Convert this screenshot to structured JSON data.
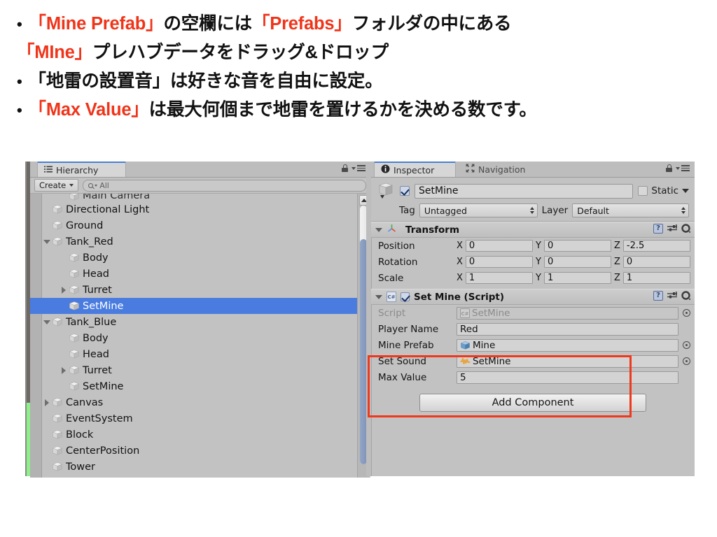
{
  "slide": {
    "lines": [
      {
        "bullet": "•",
        "segments": [
          {
            "t": "「Mine Prefab」",
            "hl": true
          },
          {
            "t": "の空欄には",
            "hl": false
          },
          {
            "t": "「Prefabs」",
            "hl": true
          },
          {
            "t": "フォルダの中にある",
            "hl": false
          }
        ]
      },
      {
        "bullet": "",
        "segments": [
          {
            "t": "「MIne」",
            "hl": true
          },
          {
            "t": "プレハブデータをドラッグ&ドロップ",
            "hl": false
          }
        ]
      },
      {
        "bullet": "•",
        "segments": [
          {
            "t": "「地雷の設置音」は好きな音を自由に設定。",
            "hl": false
          }
        ]
      },
      {
        "bullet": "•",
        "segments": [
          {
            "t": "「Max Value」",
            "hl": true
          },
          {
            "t": "は最大何個まで地雷を置けるかを決める数です。",
            "hl": false
          }
        ]
      }
    ],
    "highlight_color": "#f0341a",
    "text_color": "#111111"
  },
  "hierarchy": {
    "tab_label": "Hierarchy",
    "tab_icon": "hierarchy-icon",
    "lock_icon": "lock-icon",
    "menu_icon": "panel-menu-icon",
    "create_button": "Create",
    "search_placeholder": "All",
    "search_value": "All",
    "search_icon": "search-icon",
    "clipped_top_row": "Main Camera",
    "rows": [
      {
        "label": "Directional Light",
        "indent": 1,
        "disclosure": "none",
        "selected": false
      },
      {
        "label": "Ground",
        "indent": 1,
        "disclosure": "none",
        "selected": false
      },
      {
        "label": "Tank_Red",
        "indent": 1,
        "disclosure": "down",
        "selected": false
      },
      {
        "label": "Body",
        "indent": 2,
        "disclosure": "none",
        "selected": false
      },
      {
        "label": "Head",
        "indent": 2,
        "disclosure": "none",
        "selected": false
      },
      {
        "label": "Turret",
        "indent": 2,
        "disclosure": "right",
        "selected": false
      },
      {
        "label": "SetMine",
        "indent": 2,
        "disclosure": "none",
        "selected": true
      },
      {
        "label": "Tank_Blue",
        "indent": 1,
        "disclosure": "down",
        "selected": false
      },
      {
        "label": "Body",
        "indent": 2,
        "disclosure": "none",
        "selected": false
      },
      {
        "label": "Head",
        "indent": 2,
        "disclosure": "none",
        "selected": false
      },
      {
        "label": "Turret",
        "indent": 2,
        "disclosure": "right",
        "selected": false
      },
      {
        "label": "SetMine",
        "indent": 2,
        "disclosure": "none",
        "selected": false
      },
      {
        "label": "Canvas",
        "indent": 1,
        "disclosure": "right",
        "selected": false
      },
      {
        "label": "EventSystem",
        "indent": 1,
        "disclosure": "none",
        "selected": false
      },
      {
        "label": "Block",
        "indent": 1,
        "disclosure": "none",
        "selected": false
      },
      {
        "label": "CenterPosition",
        "indent": 1,
        "disclosure": "none",
        "selected": false
      },
      {
        "label": "Tower",
        "indent": 1,
        "disclosure": "none",
        "selected": false
      }
    ],
    "selection_color": "#4a7ce0"
  },
  "inspector": {
    "tabs": [
      {
        "label": "Inspector",
        "icon": "info-icon",
        "active": true
      },
      {
        "label": "Navigation",
        "icon": "navigation-icon",
        "active": false
      }
    ],
    "lock_icon": "lock-icon",
    "menu_icon": "panel-menu-icon",
    "gameobject": {
      "icon": "gameobject-cube-icon",
      "enabled_checkbox": "checked",
      "name": "SetMine",
      "static_label": "Static",
      "static_checkbox": "unchecked",
      "tag_label": "Tag",
      "tag_value": "Untagged",
      "layer_label": "Layer",
      "layer_value": "Default"
    },
    "components": [
      {
        "title": "Transform",
        "icon": "transform-axis-icon",
        "expanded": true,
        "help_icon": "help-icon",
        "preset_icon": "preset-icon",
        "gear_icon": "gear-icon",
        "vector_rows": [
          {
            "label": "Position",
            "x": "0",
            "y": "0",
            "z": "-2.5"
          },
          {
            "label": "Rotation",
            "x": "0",
            "y": "0",
            "z": "0"
          },
          {
            "label": "Scale",
            "x": "1",
            "y": "1",
            "z": "1"
          }
        ],
        "axis_labels": [
          "X",
          "Y",
          "Z"
        ]
      },
      {
        "title": "Set Mine (Script)",
        "icon": "csharp-script-icon",
        "expanded": true,
        "enabled_checkbox": "checked",
        "help_icon": "help-icon",
        "preset_icon": "preset-icon",
        "gear_icon": "gear-icon",
        "fields": [
          {
            "label": "Script",
            "value": "SetMine",
            "kind": "object",
            "icon": "csharp-script-icon",
            "dim": true,
            "picker": true
          },
          {
            "label": "Player Name",
            "value": "Red",
            "kind": "text",
            "icon": "",
            "dim": false,
            "picker": false
          },
          {
            "label": "Mine Prefab",
            "value": "Mine",
            "kind": "object",
            "icon": "prefab-cube-icon",
            "dim": false,
            "picker": true
          },
          {
            "label": "Set Sound",
            "value": "SetMine",
            "kind": "object",
            "icon": "audioclip-icon",
            "dim": false,
            "picker": true
          },
          {
            "label": "Max Value",
            "value": "5",
            "kind": "text",
            "icon": "",
            "dim": false,
            "picker": false
          }
        ]
      }
    ],
    "add_component_label": "Add Component"
  },
  "annotation": {
    "box_color": "#f0381c",
    "covers": [
      "Mine Prefab",
      "Set Sound",
      "Max Value"
    ]
  }
}
